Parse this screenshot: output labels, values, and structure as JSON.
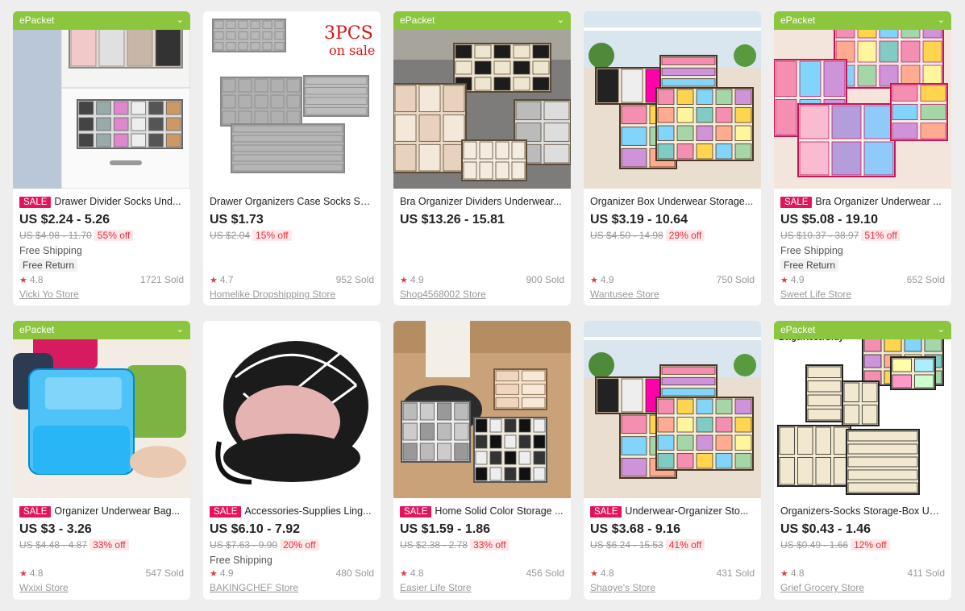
{
  "products": [
    {
      "epacket": "ePacket",
      "sale": "SALE",
      "title": "Drawer Divider Socks Und...",
      "price": "US $2.24 - 5.26",
      "original": "US $4.98 - 11.70",
      "discount": "55% off",
      "shipping": "Free Shipping",
      "free_return": "Free Return",
      "rating": "4.8",
      "sold": "1721 Sold",
      "store": "Vicki Yo Store",
      "image": "drawer-organizer-image"
    },
    {
      "epacket": "",
      "sale": "",
      "title": "Drawer Organizers Case Socks Sca...",
      "price": "US $1.73",
      "original": "US $2.04",
      "discount": "15% off",
      "shipping": "",
      "free_return": "",
      "rating": "4.7",
      "sold": "952 Sold",
      "store": "Homelike Dropshipping Store",
      "image": "gray-organizer-image",
      "image_text": [
        "3PCS",
        "on sale"
      ]
    },
    {
      "epacket": "ePacket",
      "sale": "",
      "title": "Bra Organizer Dividers Underwear...",
      "price": "US $13.26 - 15.81",
      "original": "",
      "discount": "",
      "shipping": "",
      "free_return": "",
      "rating": "4.9",
      "sold": "900 Sold",
      "store": "Shop4568002 Store",
      "image": "beige-organizer-image"
    },
    {
      "epacket": "",
      "sale": "",
      "title": "Organizer Box Underwear Storage...",
      "price": "US $3.19 - 10.64",
      "original": "US $4.50 - 14.98",
      "discount": "29% off",
      "shipping": "",
      "free_return": "",
      "rating": "4.9",
      "sold": "750 Sold",
      "store": "Wantusee Store",
      "image": "organizer-boxes-image"
    },
    {
      "epacket": "ePacket",
      "sale": "SALE",
      "title": "Bra Organizer Underwear ...",
      "price": "US $5.08 - 19.10",
      "original": "US $10.37 - 38.97",
      "discount": "51% off",
      "shipping": "Free Shipping",
      "free_return": "Free Return",
      "rating": "4.9",
      "sold": "652 Sold",
      "store": "Sweet Life Store",
      "image": "pink-organizer-image"
    },
    {
      "epacket": "ePacket",
      "sale": "SALE",
      "title": "Organizer Underwear Bag...",
      "price": "US $3 - 3.26",
      "original": "US $4.48 - 4.87",
      "discount": "33% off",
      "shipping": "",
      "free_return": "",
      "rating": "4.8",
      "sold": "547 Sold",
      "store": "Wxixi Store",
      "image": "travel-bag-image"
    },
    {
      "epacket": "",
      "sale": "SALE",
      "title": "Accessories-Supplies Ling...",
      "price": "US $6.10 - 7.92",
      "original": "US $7.63 - 9.90",
      "discount": "20% off",
      "shipping": "Free Shipping",
      "free_return": "",
      "rating": "4.9",
      "sold": "480 Sold",
      "store": "BAKINGCHEF Store",
      "image": "round-case-image"
    },
    {
      "epacket": "",
      "sale": "SALE",
      "title": "Home Solid Color Storage ...",
      "price": "US $1.59 - 1.86",
      "original": "US $2.38 - 2.78",
      "discount": "33% off",
      "shipping": "",
      "free_return": "",
      "rating": "4.8",
      "sold": "456 Sold",
      "store": "Easier Life Store",
      "image": "floor-organizer-image"
    },
    {
      "epacket": "",
      "sale": "SALE",
      "title": "Underwear-Organizer Sto...",
      "price": "US $3.68 - 9.16",
      "original": "US $6.24 - 15.53",
      "discount": "41% off",
      "shipping": "",
      "free_return": "",
      "rating": "4.8",
      "sold": "431 Sold",
      "store": "Shaoye's Store",
      "image": "organizer-boxes-image"
    },
    {
      "epacket": "ePacket",
      "sale": "",
      "title": "Organizers-Socks Storage-Box Und...",
      "price": "US $0.43 - 1.46",
      "original": "US $0.49 - 1.66",
      "discount": "12% off",
      "shipping": "",
      "free_return": "",
      "rating": "4.8",
      "sold": "411 Sold",
      "store": "Grief Grocery Store",
      "image": "beige-boxes-image",
      "image_text": [
        "Beige/Rose/Gray"
      ]
    }
  ],
  "icons": {
    "star": "★",
    "chevron": "⌄"
  },
  "colors": {
    "epacket": "#8cc63f",
    "sale": "#e4145b",
    "discount_text": "#e62e3a",
    "star": "#e23b41"
  }
}
